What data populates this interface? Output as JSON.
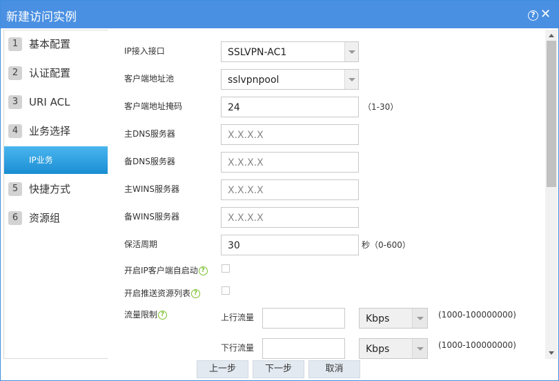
{
  "dialog": {
    "title": "新建访问实例"
  },
  "sidebar": {
    "items": [
      {
        "num": "1",
        "label": "基本配置"
      },
      {
        "num": "2",
        "label": "认证配置"
      },
      {
        "num": "3",
        "label": "URI ACL"
      },
      {
        "num": "4",
        "label": "业务选择"
      },
      {
        "num": "",
        "label": "IP业务",
        "active": true
      },
      {
        "num": "5",
        "label": "快捷方式"
      },
      {
        "num": "6",
        "label": "资源组"
      }
    ]
  },
  "form": {
    "ip_interface": {
      "label": "IP接入接口",
      "value": "SSLVPN-AC1"
    },
    "client_pool": {
      "label": "客户端地址池",
      "value": "sslvpnpool"
    },
    "client_mask": {
      "label": "客户端地址掩码",
      "value": "24",
      "hint": "（1-30）"
    },
    "primary_dns": {
      "label": "主DNS服务器",
      "placeholder": "X.X.X.X"
    },
    "backup_dns": {
      "label": "备DNS服务器",
      "placeholder": "X.X.X.X"
    },
    "primary_wins": {
      "label": "主WINS服务器",
      "placeholder": "X.X.X.X"
    },
    "backup_wins": {
      "label": "备WINS服务器",
      "placeholder": "X.X.X.X"
    },
    "keepalive": {
      "label": "保活周期",
      "value": "30",
      "hint": "秒（0-600）"
    },
    "auto_start": {
      "label": "开启IP客户端自启动"
    },
    "push_resources": {
      "label": "开启推送资源列表"
    },
    "rate_limit": {
      "label": "流量限制",
      "upstream": {
        "label": "上行流量",
        "unit": "Kbps",
        "hint": "(1000-100000000)"
      },
      "downstream": {
        "label": "下行流量",
        "unit": "Kbps",
        "hint": "(1000-100000000)"
      }
    }
  },
  "footer": {
    "prev": "上一步",
    "next": "下一步",
    "cancel": "取消"
  },
  "icons": {
    "help": "question-circle-icon",
    "close": "close-icon",
    "info": "question-circle-icon"
  },
  "colors": {
    "titlebar": "#4a90e2",
    "active_tab": "#1a8ed3",
    "help_icon": "#7bbf2c"
  }
}
